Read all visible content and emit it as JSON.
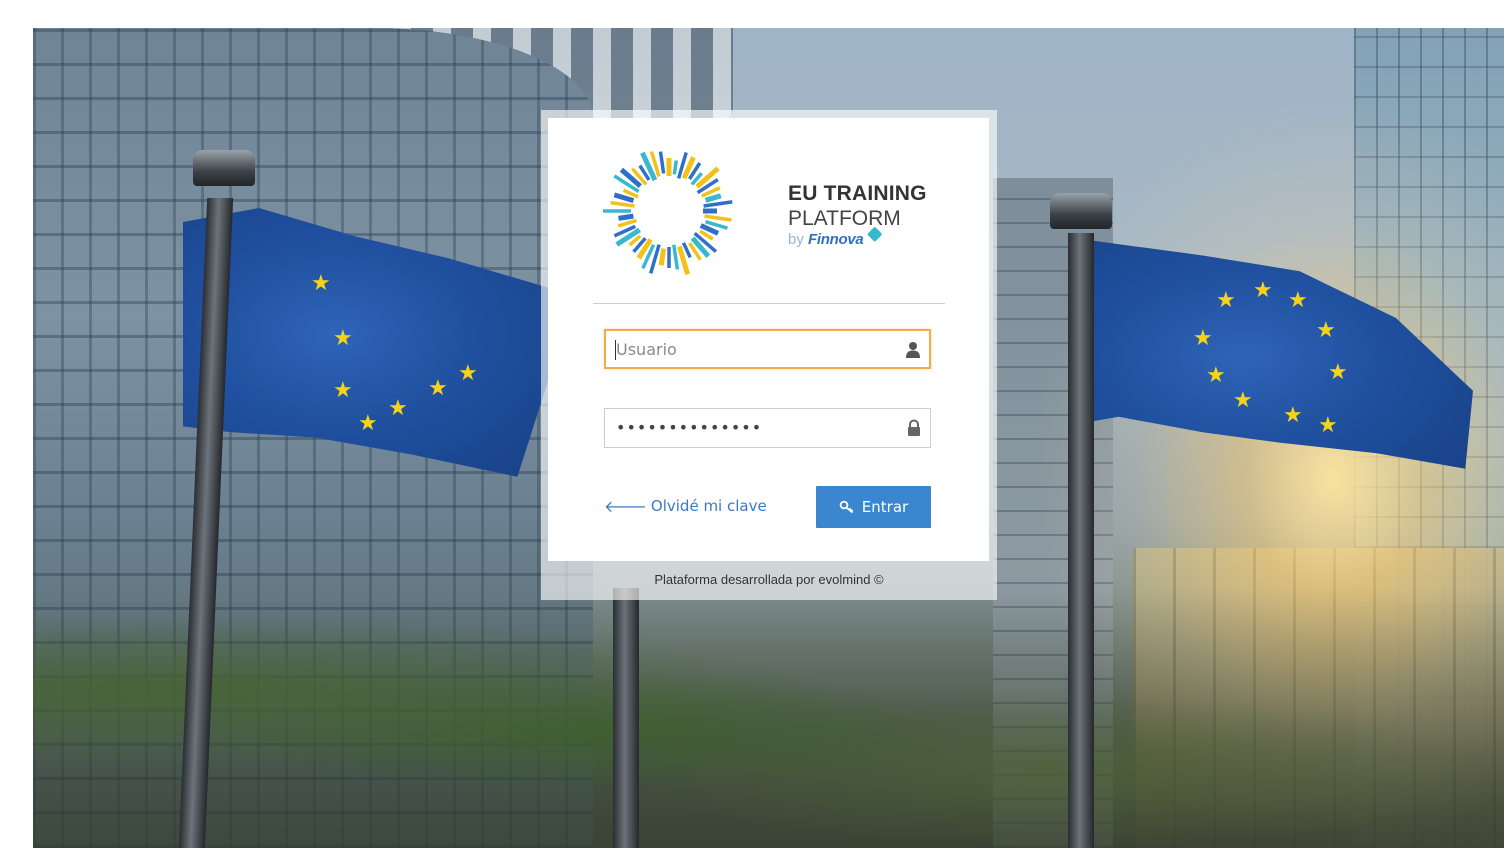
{
  "brand": {
    "title": "EU TRAINING",
    "subtitle": "PLATFORM",
    "by": "by",
    "partner": "Finnova",
    "logo_colors": {
      "blue": "#2f6fc8",
      "yellow": "#f2c21a",
      "cyan": "#37b8cf"
    }
  },
  "login": {
    "username_placeholder": "Usuario",
    "username_value": "",
    "username_icon": "user-icon",
    "password_mask": "••••••••••••••",
    "password_icon": "lock-icon",
    "forgot_label": "Olvidé mi clave",
    "forgot_icon": "arrow-left-icon",
    "submit_label": "Entrar",
    "submit_icon": "key-icon"
  },
  "footer": {
    "text": "Plataforma desarrollada por evolmind ©"
  },
  "colors": {
    "accent": "#3a86cf",
    "focus_border": "#f0ad4e",
    "link": "#3a79c9"
  }
}
